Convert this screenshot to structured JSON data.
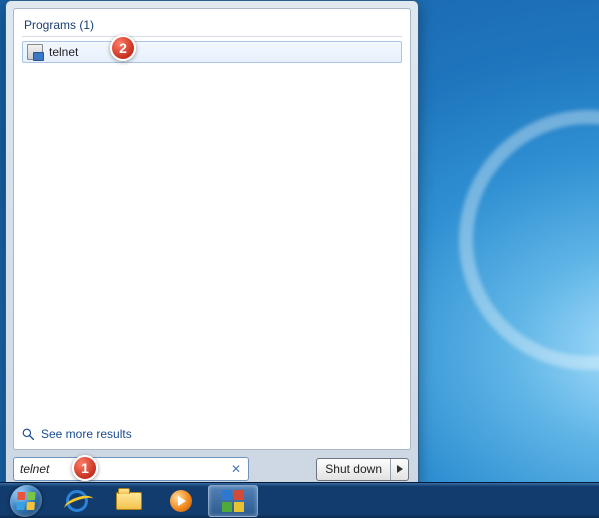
{
  "start_menu": {
    "section_header": "Programs (1)",
    "results": [
      {
        "label": "telnet"
      }
    ],
    "see_more": "See more results",
    "search_value": "telnet",
    "shutdown_label": "Shut down"
  },
  "callouts": {
    "c1": "1",
    "c2": "2"
  }
}
